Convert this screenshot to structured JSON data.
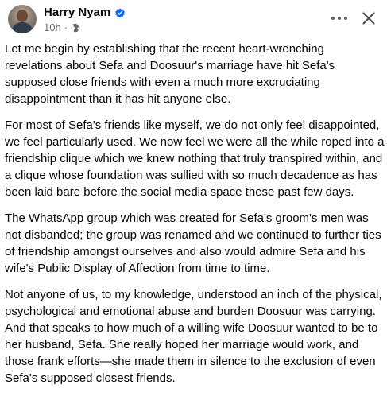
{
  "header": {
    "author_name": "Harry Nyam",
    "timestamp": "10h",
    "separator": "·",
    "audience_icon": "globe-icon",
    "verified_icon": "verified-badge-icon",
    "verified_color": "#0866ff",
    "more_icon": "more-options-icon",
    "close_icon": "close-icon"
  },
  "post": {
    "paragraphs": [
      "Let me begin by establishing that the recent heart-wrenching revelations about Sefa and Doosuur's marriage have hit Sefa's supposed close friends with even a much more excruciating disappointment than it has hit anyone else.",
      "For most of Sefa's friends like myself, we do not only feel disappointed, we feel particularly used. We now feel we were all the while roped into a friendship clique which we knew nothing that truly transpired within, and a clique whose foundation was sullied with so much decadence as has been laid bare before the social media space these past few days.",
      "The WhatsApp group which was created for Sefa's groom's men was not disbanded; the group was renamed and we continued to further ties of friendship amongst ourselves and also would admire Sefa and his wife's Public Display of Affection from time to time.",
      "Not anyone of us, to my knowledge, understood an inch of the physical, psychological and emotional abuse and burden Doosuur was carrying. And that speaks to how much of a willing wife Doosuur wanted to be to her husband, Sefa. She really hoped her marriage would work, and those frank efforts—she made them in silence to the exclusion of even Sefa's supposed closest friends."
    ]
  }
}
